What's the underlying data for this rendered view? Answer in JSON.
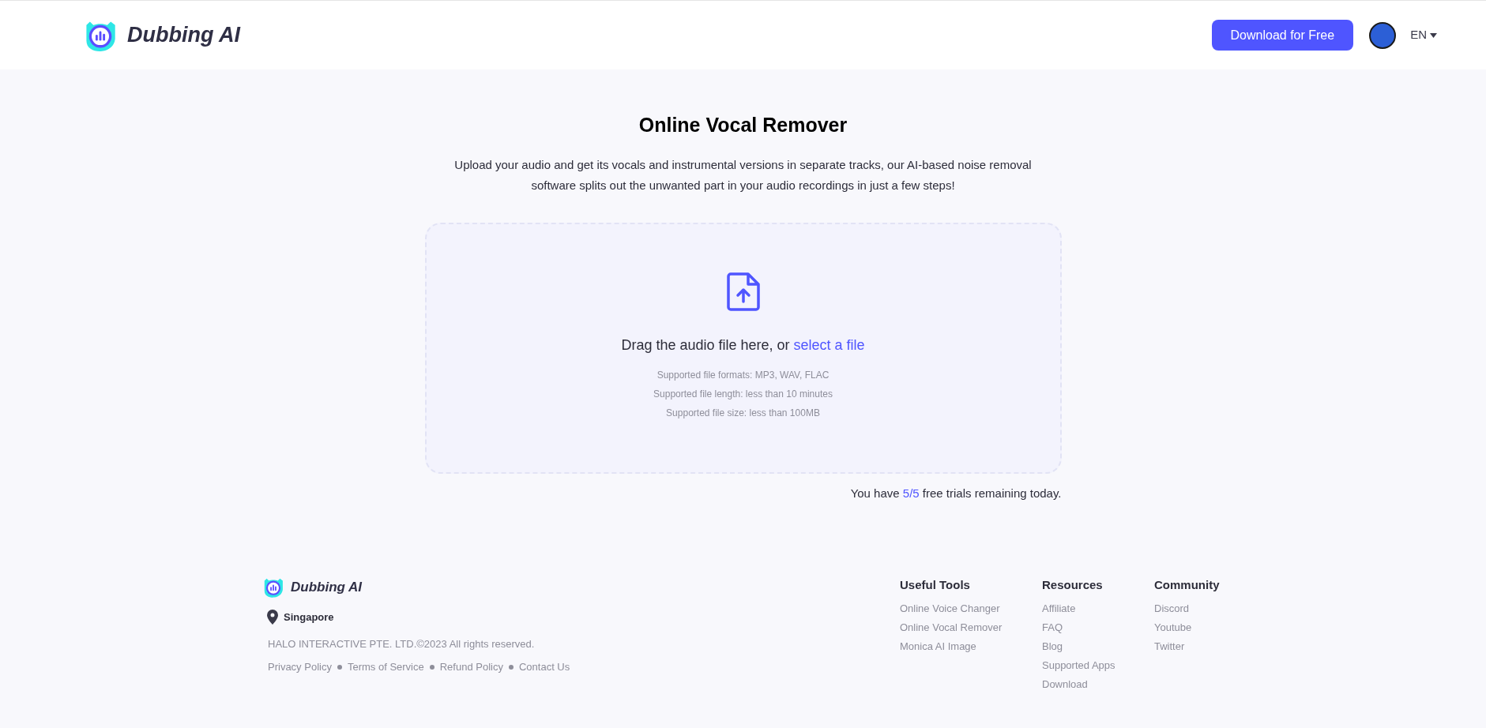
{
  "header": {
    "brand": "Dubbing AI",
    "download_button": "Download for Free",
    "language": "EN"
  },
  "main": {
    "title": "Online Vocal Remover",
    "description": "Upload your audio and get its vocals and instrumental versions in separate tracks, our AI-based noise removal software splits out the unwanted part in your audio recordings in just a few steps!",
    "dropzone": {
      "prompt": "Drag the audio file here, or ",
      "link": "select a file",
      "notes": [
        "Supported file formats: MP3, WAV, FLAC",
        "Supported file length: less than 10 minutes",
        "Supported file size: less than 100MB"
      ]
    },
    "trials": {
      "prefix": "You have ",
      "count": "5/5",
      "suffix": " free trials remaining today."
    }
  },
  "footer": {
    "brand": "Dubbing AI",
    "location": "Singapore",
    "copyright": "HALO INTERACTIVE PTE. LTD.©2023 All rights reserved.",
    "legal_links": [
      "Privacy Policy",
      "Terms of Service",
      "Refund Policy",
      "Contact Us"
    ],
    "columns": [
      {
        "heading": "Useful Tools",
        "links": [
          "Online Voice Changer",
          "Online Vocal Remover",
          "Monica AI Image"
        ]
      },
      {
        "heading": "Resources",
        "links": [
          "Affiliate",
          "FAQ",
          "Blog",
          "Supported Apps",
          "Download"
        ]
      },
      {
        "heading": "Community",
        "links": [
          "Discord",
          "Youtube",
          "Twitter"
        ]
      }
    ]
  }
}
